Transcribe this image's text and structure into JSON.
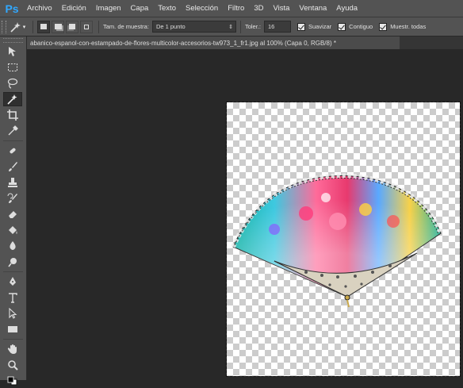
{
  "app": {
    "logo": "Ps"
  },
  "menu": [
    "Archivo",
    "Edición",
    "Imagen",
    "Capa",
    "Texto",
    "Selección",
    "Filtro",
    "3D",
    "Vista",
    "Ventana",
    "Ayuda"
  ],
  "options": {
    "sample_size_label": "Tam. de muestra:",
    "sample_size_value": "De 1 punto",
    "tolerance_label": "Toler.:",
    "tolerance_value": "16",
    "antialias_label": "Suavizar",
    "contiguous_label": "Contiguo",
    "sample_all_label": "Muestr. todas"
  },
  "document": {
    "tab_title": "abanico-espanol-con-estampado-de-flores-multicolor-accesorios-tw973_1_fr1.jpg al 100% (Capa 0, RGB/8) *"
  },
  "tools": [
    "move-icon",
    "marquee-icon",
    "lasso-icon",
    "magic-wand-icon",
    "crop-icon",
    "eyedropper-icon",
    "healing-brush-icon",
    "brush-icon",
    "clone-stamp-icon",
    "history-brush-icon",
    "eraser-icon",
    "paint-bucket-icon",
    "blur-icon",
    "dodge-icon",
    "pen-icon",
    "type-icon",
    "path-selection-icon",
    "rectangle-icon",
    "hand-icon",
    "zoom-icon",
    "color-swatches-icon"
  ],
  "active_tool": "magic-wand-icon"
}
